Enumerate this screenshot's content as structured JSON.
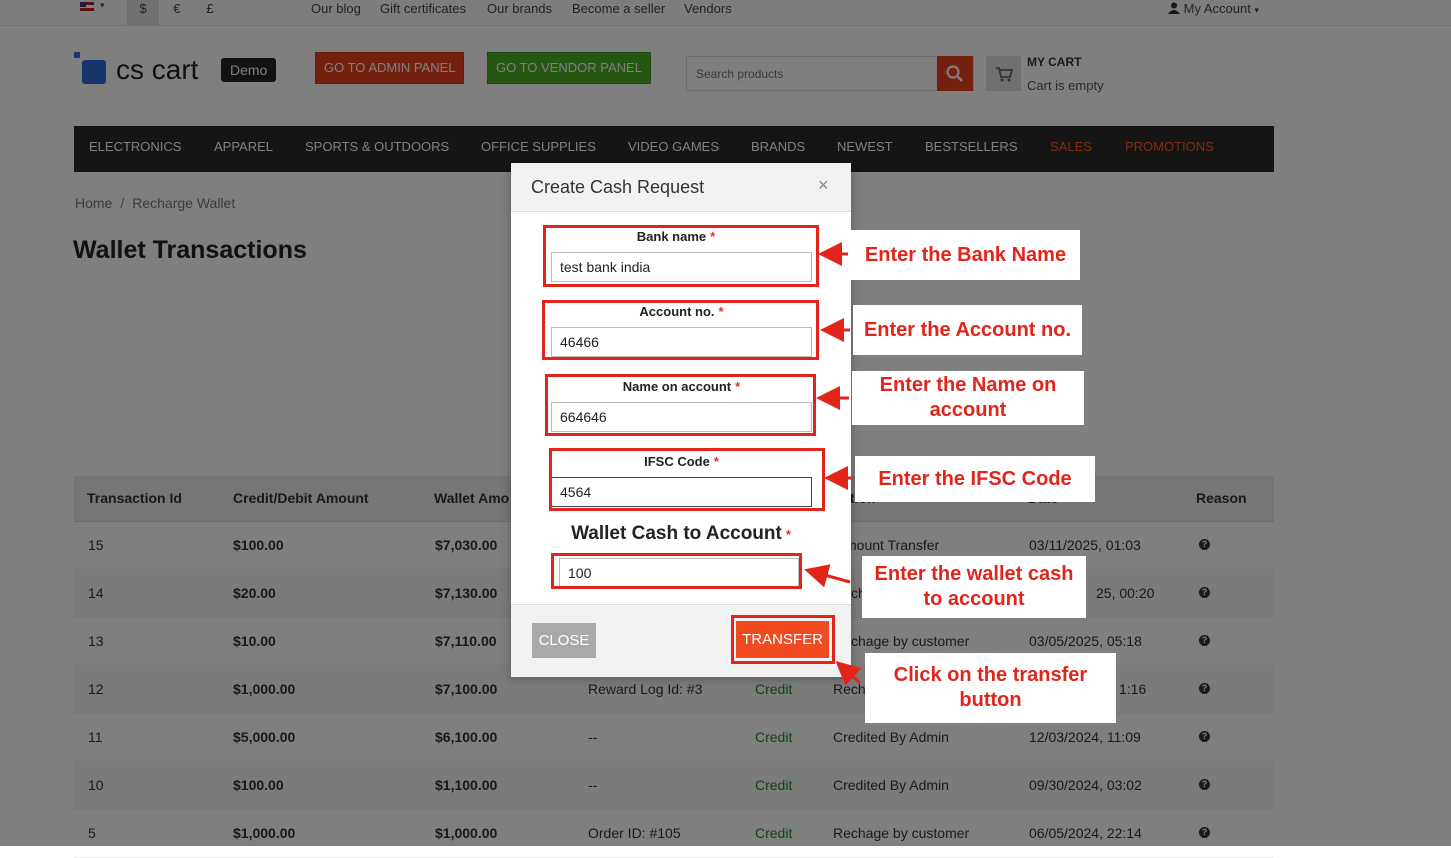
{
  "topbar": {
    "currencies": [
      "$",
      "€",
      "£"
    ],
    "links": [
      "Our blog",
      "Gift certificates",
      "Our brands",
      "Become a seller",
      "Vendors"
    ],
    "account": "My Account"
  },
  "header": {
    "logo_text": "cs cart",
    "logo_badge": "Demo",
    "admin_button": "GO TO ADMIN PANEL",
    "vendor_button": "GO TO VENDOR PANEL",
    "search_placeholder": "Search products",
    "cart_title": "MY CART",
    "cart_status": "Cart is empty",
    "colors": {
      "admin": "#e8411f",
      "vendor": "#4caf27",
      "search": "#e8411f"
    }
  },
  "menu": [
    "ELECTRONICS",
    "APPAREL",
    "SPORTS & OUTDOORS",
    "OFFICE SUPPLIES",
    "VIDEO GAMES",
    "BRANDS",
    "NEWEST",
    "BESTSELLERS",
    "SALES",
    "PROMOTIONS"
  ],
  "breadcrumb": {
    "home": "Home",
    "separator": "/",
    "current": "Recharge Wallet"
  },
  "page_title": "Wallet Transactions",
  "table": {
    "headers": [
      "Transaction Id",
      "Credit/Debit Amount",
      "Wallet Amo",
      "",
      "",
      "ation",
      "Date",
      "Reason"
    ],
    "rows": [
      {
        "id": "15",
        "amount": "$100.00",
        "wallet": "$7,030.00",
        "source": "",
        "type": "",
        "description": "mount Transfer",
        "date": "03/11/2025, 01:03"
      },
      {
        "id": "14",
        "amount": "$20.00",
        "wallet": "$7,130.00",
        "source": "",
        "type": "",
        "description": "ch",
        "date": "25, 00:20"
      },
      {
        "id": "13",
        "amount": "$10.00",
        "wallet": "$7,110.00",
        "source": "",
        "type": "",
        "description": "chage by customer",
        "date": "03/05/2025, 05:18"
      },
      {
        "id": "12",
        "amount": "$1,000.00",
        "wallet": "$7,100.00",
        "source": "Reward Log Id: #3",
        "type": "Credit",
        "description": "Rech",
        "date": "1:16"
      },
      {
        "id": "11",
        "amount": "$5,000.00",
        "wallet": "$6,100.00",
        "source": "--",
        "type": "Credit",
        "description": "Credited By Admin",
        "date": "12/03/2024, 11:09"
      },
      {
        "id": "10",
        "amount": "$100.00",
        "wallet": "$1,100.00",
        "source": "--",
        "type": "Credit",
        "description": "Credited By Admin",
        "date": "09/30/2024, 03:02"
      },
      {
        "id": "5",
        "amount": "$1,000.00",
        "wallet": "$1,000.00",
        "source": "Order ID: #105",
        "type": "Credit",
        "description": "Rechage by customer",
        "date": "06/05/2024, 22:14"
      }
    ]
  },
  "modal": {
    "title": "Create Cash Request",
    "close_symbol": "×",
    "required_mark": "*",
    "bank_name": {
      "label": "Bank name",
      "value": "test bank india"
    },
    "account_no": {
      "label": "Account no.",
      "value": "46466"
    },
    "name_on_account": {
      "label": "Name on account",
      "value": "664646"
    },
    "ifsc_code": {
      "label": "IFSC Code",
      "value": "4564"
    },
    "wallet_cash": {
      "label": "Wallet Cash to Account",
      "value": "100"
    },
    "close_button": "CLOSE",
    "transfer_button": "TRANSFER"
  },
  "annotations": {
    "bank": "Enter the Bank Name",
    "account": "Enter the Account no.",
    "name": [
      "Enter the Name on",
      "account"
    ],
    "ifsc": "Enter the IFSC Code",
    "wallet": [
      "Enter the wallet cash",
      "to account"
    ],
    "transfer": [
      "Click on the transfer",
      "button"
    ],
    "color": "#e1251b"
  }
}
